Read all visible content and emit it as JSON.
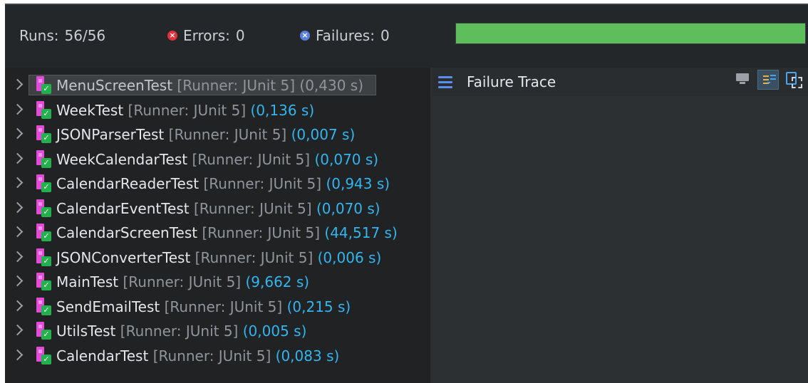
{
  "counters": {
    "runs_label": "Runs:",
    "runs_value": "56/56",
    "errors_label": "Errors:",
    "errors_value": "0",
    "failures_label": "Failures:",
    "failures_value": "0",
    "progress_fraction": 1.0,
    "progress_color": "#5cbf5c"
  },
  "tests": [
    {
      "name": "MenuScreenTest",
      "runner": "[Runner: JUnit 5]",
      "time": "(0,430 s)",
      "selected": true
    },
    {
      "name": "WeekTest",
      "runner": "[Runner: JUnit 5]",
      "time": "(0,136 s)"
    },
    {
      "name": "JSONParserTest",
      "runner": "[Runner: JUnit 5]",
      "time": "(0,007 s)"
    },
    {
      "name": "WeekCalendarTest",
      "runner": "[Runner: JUnit 5]",
      "time": "(0,070 s)"
    },
    {
      "name": "CalendarReaderTest",
      "runner": "[Runner: JUnit 5]",
      "time": "(0,943 s)"
    },
    {
      "name": "CalendarEventTest",
      "runner": "[Runner: JUnit 5]",
      "time": "(0,070 s)"
    },
    {
      "name": "CalendarScreenTest",
      "runner": "[Runner: JUnit 5]",
      "time": "(44,517 s)"
    },
    {
      "name": "JSONConverterTest",
      "runner": "[Runner: JUnit 5]",
      "time": "(0,006 s)"
    },
    {
      "name": "MainTest",
      "runner": "[Runner: JUnit 5]",
      "time": "(9,662 s)"
    },
    {
      "name": "SendEmailTest",
      "runner": "[Runner: JUnit 5]",
      "time": "(0,215 s)"
    },
    {
      "name": "UtilsTest",
      "runner": "[Runner: JUnit 5]",
      "time": "(0,005 s)"
    },
    {
      "name": "CalendarTest",
      "runner": "[Runner: JUnit 5]",
      "time": "(0,083 s)"
    }
  ],
  "trace": {
    "title": "Failure Trace",
    "icons": [
      "menu-icon",
      "monitor-icon",
      "filter-stack-trace-icon",
      "compare-results-icon"
    ]
  },
  "icons": {
    "test_item": "junit-test-passed-icon",
    "expand": "chevron-right-icon"
  },
  "colors": {
    "duration": "#33b5f0",
    "runner": "#8f959b",
    "test_name": "#e3e6ea",
    "error": "#e1323a",
    "failure": "#5a7fe0"
  }
}
